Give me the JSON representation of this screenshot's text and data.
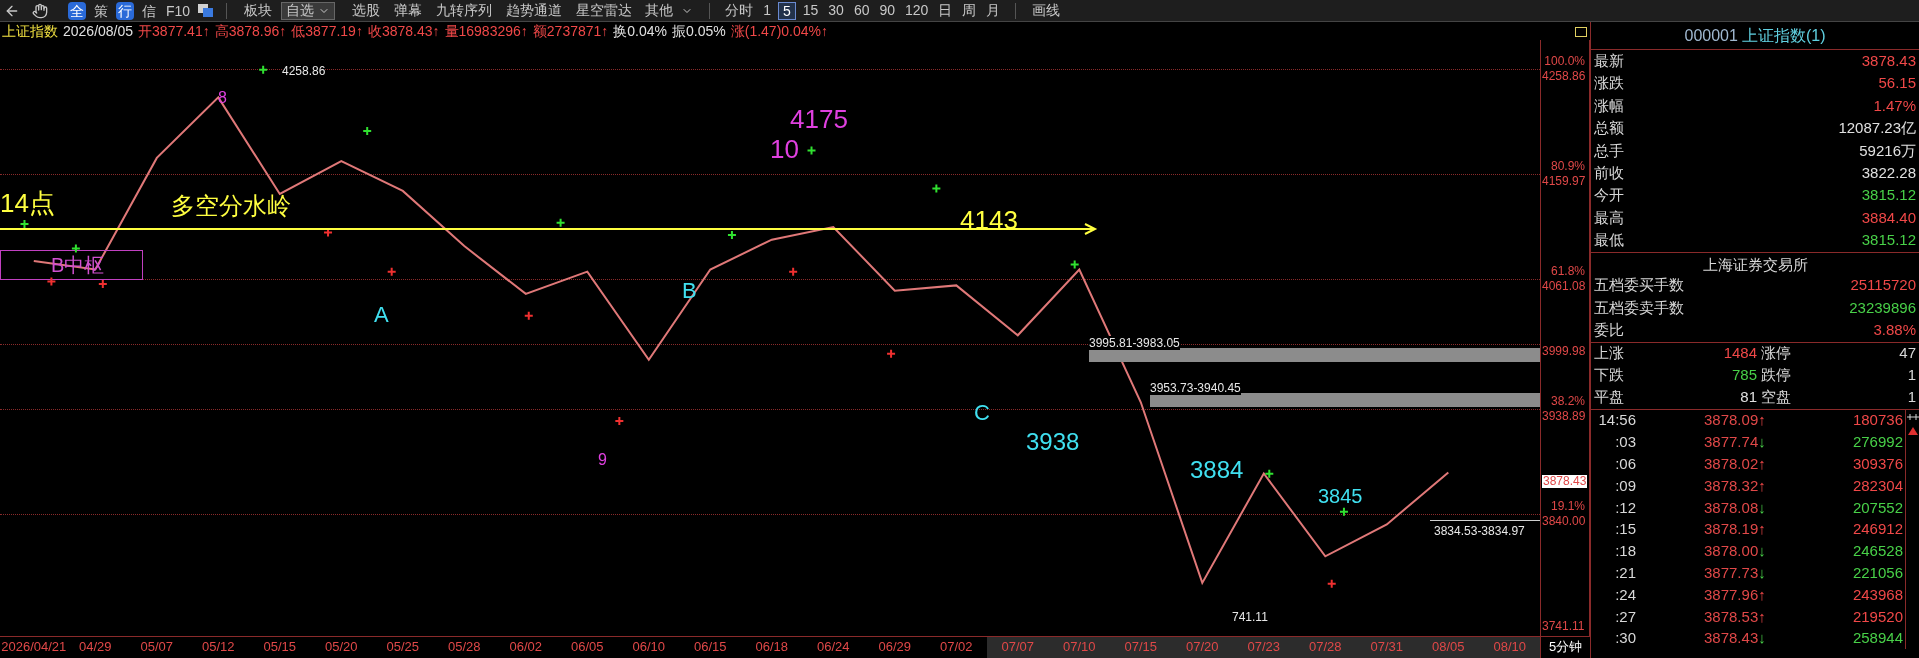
{
  "toolbar": {
    "quick": [
      {
        "label": "全",
        "highlighted": true
      },
      {
        "label": "策",
        "highlighted": false
      },
      {
        "label": "行",
        "highlighted": true
      },
      {
        "label": "信",
        "highlighted": false
      },
      {
        "label": "F10",
        "highlighted": false
      }
    ],
    "menus": [
      {
        "label": "板块",
        "kind": "plain"
      },
      {
        "label": "自选",
        "kind": "select"
      },
      {
        "label": "选股",
        "kind": "plain"
      },
      {
        "label": "弹幕",
        "kind": "plain"
      },
      {
        "label": "九转序列",
        "kind": "plain"
      },
      {
        "label": "趋势通道",
        "kind": "plain"
      },
      {
        "label": "星空雷达",
        "kind": "plain"
      },
      {
        "label": "其他",
        "kind": "menu"
      }
    ],
    "periods": [
      {
        "label": "分时",
        "selected": false
      },
      {
        "label": "1",
        "selected": false
      },
      {
        "label": "5",
        "selected": true
      },
      {
        "label": "15",
        "selected": false
      },
      {
        "label": "30",
        "selected": false
      },
      {
        "label": "60",
        "selected": false
      },
      {
        "label": "90",
        "selected": false
      },
      {
        "label": "120",
        "selected": false
      },
      {
        "label": "日",
        "selected": false
      },
      {
        "label": "周",
        "selected": false
      },
      {
        "label": "月",
        "selected": false
      }
    ],
    "draw": "画线"
  },
  "info_line": [
    {
      "text": "上证指数",
      "color": "#f0e040"
    },
    {
      "text": "2026/08/05",
      "color": "#e0e0e0"
    },
    {
      "text": "开3877.41↑",
      "color": "#f04848"
    },
    {
      "text": "高3878.96↑",
      "color": "#f04848"
    },
    {
      "text": "低3877.19↑",
      "color": "#f04848"
    },
    {
      "text": "收3878.43↑",
      "color": "#f04848"
    },
    {
      "text": "量16983296↑",
      "color": "#f04848"
    },
    {
      "text": "额2737871↑",
      "color": "#f04848"
    },
    {
      "text": "换0.04%",
      "color": "#e0e0e0"
    },
    {
      "text": "振0.05%",
      "color": "#e0e0e0"
    },
    {
      "text": "涨(1.47)0.04%↑",
      "color": "#f04848"
    }
  ],
  "chart": {
    "annotations": [
      {
        "text": "14点",
        "kind": "wave",
        "color": "#ffff40"
      },
      {
        "text": "多空分水岭",
        "kind": "wave",
        "color": "#ffff40"
      },
      {
        "text": "8",
        "kind": "wave",
        "color": "#e040e0"
      },
      {
        "text": "4175",
        "kind": "wave",
        "color": "#e040e0"
      },
      {
        "text": "10",
        "kind": "wave",
        "color": "#e040e0"
      },
      {
        "text": "4143",
        "kind": "wave",
        "color": "#ffff40"
      },
      {
        "text": "A",
        "kind": "wave",
        "color": "#40e0f0"
      },
      {
        "text": "B",
        "kind": "wave",
        "color": "#40e0f0"
      },
      {
        "text": "9",
        "kind": "wave",
        "color": "#e040e0"
      },
      {
        "text": "C",
        "kind": "wave",
        "color": "#40e0f0"
      },
      {
        "text": "3938",
        "kind": "wave",
        "color": "#40e0f0"
      },
      {
        "text": "3884",
        "kind": "wave",
        "color": "#40e0f0"
      },
      {
        "text": "3845",
        "kind": "wave",
        "color": "#40e0f0"
      },
      {
        "text": "4258.86",
        "kind": "note",
        "color": "#e8e8e8"
      },
      {
        "text": "3995.81-3983.05",
        "kind": "note",
        "color": "#e8e8e8"
      },
      {
        "text": "3953.73-3940.45",
        "kind": "note",
        "color": "#e8e8e8"
      },
      {
        "text": "3834.53-3834.97",
        "kind": "note",
        "color": "#e8e8e8"
      },
      {
        "text": "741.11",
        "kind": "note",
        "color": "#e8e8e8"
      }
    ],
    "pivot_box": "B中枢",
    "levels": [
      "100.0%",
      "80.9%",
      "61.8%",
      "38.2%",
      "19.1%"
    ],
    "current_price": "3878.43",
    "period_label": "5分钟",
    "date_highlight": [
      false,
      false,
      false,
      false,
      false,
      false,
      false,
      false,
      false,
      false,
      false,
      false,
      false,
      false,
      false,
      false,
      true,
      true,
      true,
      true,
      true,
      true,
      true,
      true,
      true
    ],
    "chart_data": {
      "type": "line",
      "ylim": [
        3725,
        4286
      ],
      "grid": true,
      "bands": [
        {
          "axis": "y",
          "from": 3983.05,
          "to": 3995.81
        },
        {
          "axis": "y",
          "from": 3940.45,
          "to": 3953.73
        }
      ],
      "yticks": [
        {
          "value": 4258.86,
          "label": "4258.86"
        },
        {
          "value": 4159.97,
          "label": "4159.97"
        },
        {
          "value": 4061.08,
          "label": "4061.08"
        },
        {
          "value": 3999.98,
          "label": "3999.98"
        },
        {
          "value": 3938.89,
          "label": "3938.89"
        },
        {
          "value": 3840.0,
          "label": "3840.00"
        },
        {
          "value": 3741.11,
          "label": "3741.11"
        }
      ],
      "categories": [
        "2026/04/21",
        "04/29",
        "05/07",
        "05/12",
        "05/15",
        "05/20",
        "05/25",
        "05/28",
        "06/02",
        "06/05",
        "06/10",
        "06/15",
        "06/18",
        "06/24",
        "06/29",
        "07/02",
        "07/07",
        "07/10",
        "07/15",
        "07/20",
        "07/23",
        "07/28",
        "07/31",
        "08/05",
        "08/10"
      ],
      "series": [
        {
          "color": "#e07878",
          "values": [
            4078,
            4070,
            4175,
            4232,
            4141,
            4172,
            4144,
            4092,
            4047,
            4068,
            3985,
            4070,
            4098,
            4110,
            4050,
            4055,
            4008,
            4070,
            3945,
            3775,
            3878,
            3800,
            3830,
            3879,
            null
          ]
        }
      ]
    }
  },
  "panel": {
    "code": "000001",
    "name": "上证指数(1)",
    "quotes": [
      {
        "label": "最新",
        "value": "3878.43",
        "color": "#f04848"
      },
      {
        "label": "涨跌",
        "value": "56.15",
        "color": "#f04848"
      },
      {
        "label": "涨幅",
        "value": "1.47%",
        "color": "#f04848"
      },
      {
        "label": "总额",
        "value": "12087.23亿",
        "color": "#e0e0e0"
      },
      {
        "label": "总手",
        "value": "59216万",
        "color": "#e0e0e0"
      },
      {
        "label": "前收",
        "value": "3822.28",
        "color": "#e0e0e0"
      },
      {
        "label": "今开",
        "value": "3815.12",
        "color": "#48d048"
      },
      {
        "label": "最高",
        "value": "3884.40",
        "color": "#f04848"
      },
      {
        "label": "最低",
        "value": "3815.12",
        "color": "#48d048"
      }
    ],
    "exchange": "上海证券交易所",
    "orders": [
      {
        "label": "五档委买手数",
        "value": "25115720",
        "color": "#f04848"
      },
      {
        "label": "五档委卖手数",
        "value": "23239896",
        "color": "#48d048"
      },
      {
        "label": "委比",
        "value": "3.88%",
        "color": "#f04848"
      }
    ],
    "breadth": [
      {
        "label": "上涨",
        "value": "1484",
        "color": "#f04848",
        "label2": "涨停",
        "value2": "47"
      },
      {
        "label": "下跌",
        "value": "785",
        "color": "#48d048",
        "label2": "跌停",
        "value2": "1"
      },
      {
        "label": "平盘",
        "value": "81",
        "color": "#e0e0e0",
        "label2": "空盘",
        "value2": "1"
      }
    ],
    "ticks": [
      {
        "time": "14:56",
        "price": "3878.09",
        "arrow": "↑",
        "rising": true,
        "volume": "180736"
      },
      {
        "time": ":03",
        "price": "3877.74",
        "arrow": "↓",
        "rising": false,
        "volume": "276992"
      },
      {
        "time": ":06",
        "price": "3878.02",
        "arrow": "↑",
        "rising": true,
        "volume": "309376"
      },
      {
        "time": ":09",
        "price": "3878.32",
        "arrow": "↑",
        "rising": true,
        "volume": "282304"
      },
      {
        "time": ":12",
        "price": "3878.08",
        "arrow": "↓",
        "rising": false,
        "volume": "207552"
      },
      {
        "time": ":15",
        "price": "3878.19",
        "arrow": "↑",
        "rising": true,
        "volume": "246912"
      },
      {
        "time": ":18",
        "price": "3878.00",
        "arrow": "↓",
        "rising": false,
        "volume": "246528"
      },
      {
        "time": ":21",
        "price": "3877.73",
        "arrow": "↓",
        "rising": false,
        "volume": "221056"
      },
      {
        "time": ":24",
        "price": "3877.96",
        "arrow": "↑",
        "rising": true,
        "volume": "243968"
      },
      {
        "time": ":27",
        "price": "3878.53",
        "arrow": "↑",
        "rising": true,
        "volume": "219520"
      },
      {
        "time": ":30",
        "price": "3878.43",
        "arrow": "↓",
        "rising": false,
        "volume": "258944"
      }
    ]
  }
}
